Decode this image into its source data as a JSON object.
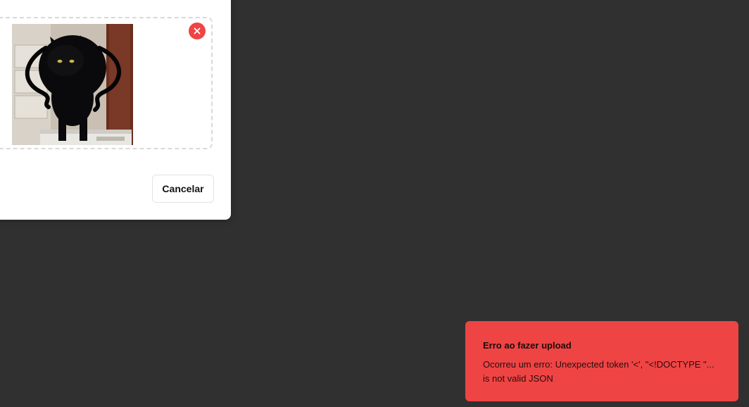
{
  "dialog": {
    "cancel_label": "Cancelar",
    "remove_icon": "close-icon",
    "preview_alt": "cat"
  },
  "toast": {
    "title": "Erro ao fazer upload",
    "description": "Ocorreu um erro: Unexpected token '<', \"<!DOCTYPE \"... is not valid JSON",
    "color": "#ef4444"
  },
  "colors": {
    "background": "#303030",
    "danger": "#ef4444",
    "panel": "#ffffff"
  }
}
